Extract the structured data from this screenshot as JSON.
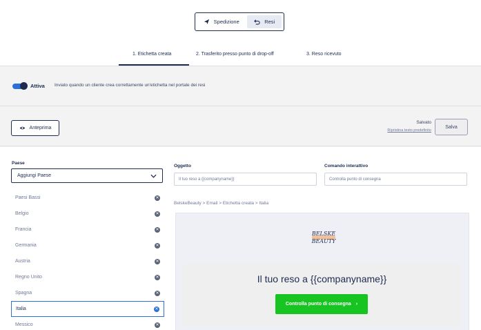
{
  "segmented": {
    "shipping_label": "Spedizione",
    "returns_label": "Resi"
  },
  "steps": [
    {
      "label": "1. Etichetta creata"
    },
    {
      "label": "2. Trasferito presso punto di drop-off"
    },
    {
      "label": "3. Reso ricevuto"
    }
  ],
  "toggle": {
    "label": "Attiva",
    "description": "Inviato quando un cliente crea correttamente un'etichetta nel portale dei resi"
  },
  "actions": {
    "preview_label": "Anteprima",
    "saved_status": "Salvato",
    "restore_link": "Ripristina testo predefinito",
    "save_label": "Salva"
  },
  "countries": {
    "label": "Paese",
    "select_value": "Aggiungi Paese",
    "items": [
      {
        "name": "Paesi Bassi"
      },
      {
        "name": "Belgio"
      },
      {
        "name": "Francia"
      },
      {
        "name": "Germania"
      },
      {
        "name": "Austria"
      },
      {
        "name": "Regno Unito"
      },
      {
        "name": "Spagna"
      },
      {
        "name": "Italia"
      },
      {
        "name": "Messico"
      }
    ],
    "selected": "Italia"
  },
  "form": {
    "subject_label": "Oggetto",
    "subject_value": "Il tuo reso a {{companyname}}",
    "cta_label": "Comando interattivo",
    "cta_value": "Controlla punto di consegna"
  },
  "breadcrumb": "BelskeBeauty > Email > Etichetta creata > Italia",
  "email": {
    "logo_line1": "BELSKE",
    "logo_line2": "BEAUTY",
    "title": "Il tuo reso a {{companyname}}",
    "button": "Controlla punto di consegna"
  },
  "colors": {
    "navy": "#1d2b4f",
    "accent_blue": "#2c6fd6",
    "cta_green": "#18c422",
    "logo_peach": "#f2b07f"
  }
}
